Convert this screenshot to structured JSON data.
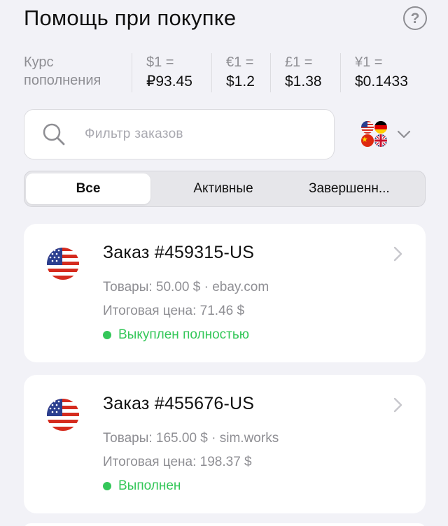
{
  "header": {
    "title": "Помощь при покупке",
    "help_glyph": "?"
  },
  "rates": {
    "label": "Курс пополнения",
    "items": [
      {
        "key": "$1 =",
        "value": "₽93.45"
      },
      {
        "key": "€1 =",
        "value": "$1.2"
      },
      {
        "key": "£1 =",
        "value": "$1.38"
      },
      {
        "key": "¥1 =",
        "value": "$0.1433"
      }
    ]
  },
  "search": {
    "placeholder": "Фильтр заказов",
    "icon": "search-icon"
  },
  "flags_filter": {
    "icons": [
      "us-flag-icon",
      "de-flag-icon",
      "cn-flag-icon",
      "uk-flag-icon"
    ],
    "chevron": "chevron-down-icon"
  },
  "tabs": [
    {
      "label": "Все",
      "active": true
    },
    {
      "label": "Активные",
      "active": false
    },
    {
      "label": "Завершенн...",
      "active": false
    }
  ],
  "orders": [
    {
      "title": "Заказ #459315-US",
      "goods": "Товары: 50.00 $ · ebay.com",
      "total": "Итоговая цена: 71.46 $",
      "status": "Выкуплен полностью",
      "status_color": "#34c759",
      "flag": "us-flag-icon"
    },
    {
      "title": "Заказ #455676-US",
      "goods": "Товары: 165.00 $ · sim.works",
      "total": "Итоговая цена: 198.37 $",
      "status": "Выполнен",
      "status_color": "#34c759",
      "flag": "us-flag-icon"
    }
  ],
  "colors": {
    "background": "#f2f2f7",
    "secondary_text": "#8e8e93",
    "success": "#34c759"
  }
}
